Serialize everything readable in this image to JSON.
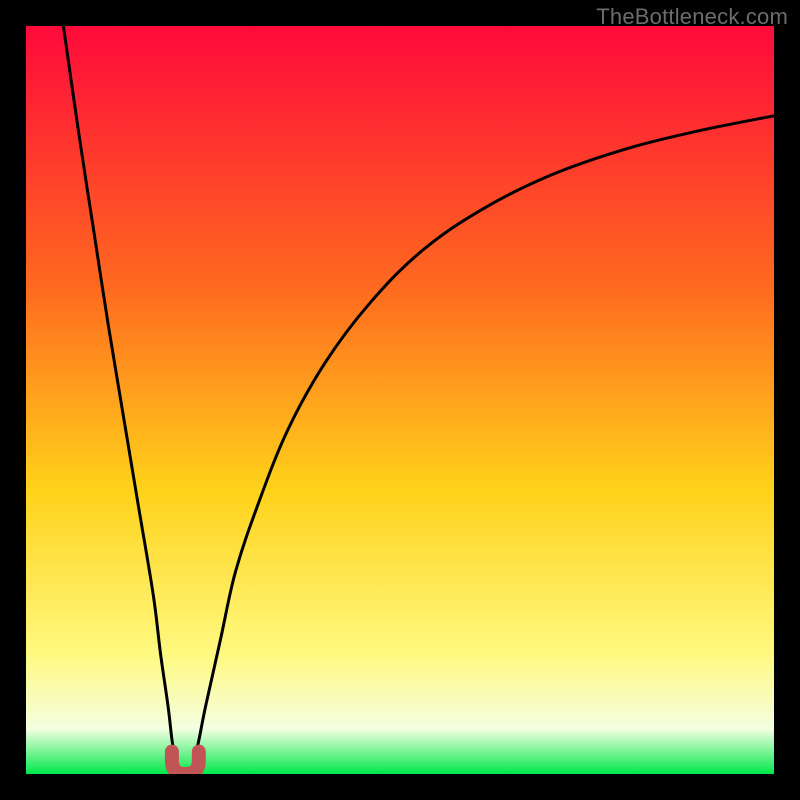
{
  "watermark": "TheBottleneck.com",
  "colors": {
    "gradient_top": "#ff0a3b",
    "gradient_upper_mid": "#ff6a1f",
    "gradient_mid": "#ffd21a",
    "gradient_lower_mid": "#fff980",
    "gradient_low": "#f3ffe0",
    "gradient_bottom": "#00e84b",
    "curve": "#000000",
    "marker": "#c15454",
    "frame": "#000000"
  },
  "chart_data": {
    "type": "line",
    "title": "",
    "xlabel": "",
    "ylabel": "",
    "xlim": [
      0,
      100
    ],
    "ylim": [
      0,
      100
    ],
    "grid": false,
    "legend": false,
    "annotations": [],
    "series": [
      {
        "name": "left-branch",
        "x": [
          5,
          7,
          9,
          11,
          13,
          15,
          17,
          18,
          19,
          19.6,
          20.2
        ],
        "y": [
          100,
          86,
          73,
          60,
          48,
          36,
          24,
          16,
          9,
          4,
          2
        ]
      },
      {
        "name": "right-branch",
        "x": [
          22.4,
          23,
          24,
          26,
          28,
          31,
          35,
          40,
          46,
          53,
          61,
          70,
          80,
          90,
          100
        ],
        "y": [
          2,
          4,
          9,
          18,
          27,
          36,
          46,
          55,
          63,
          70,
          75.5,
          80,
          83.5,
          86,
          88
        ]
      }
    ],
    "marker": {
      "name": "u-marker",
      "shape": "U",
      "x_center": 21.3,
      "y_center": 1.5,
      "width": 3.6,
      "height": 3.0
    }
  }
}
